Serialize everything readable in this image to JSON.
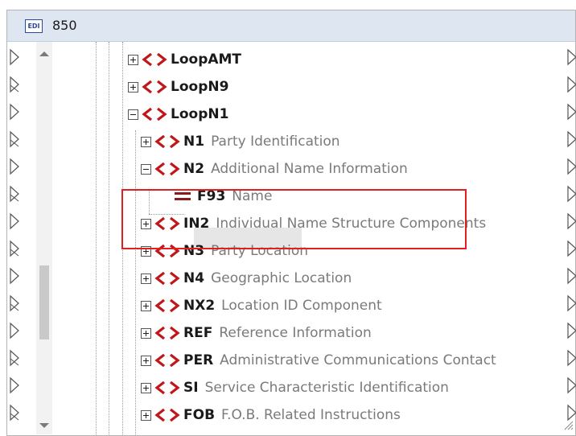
{
  "window": {
    "icon": "edi-icon",
    "icon_text": "EDI",
    "title": "850"
  },
  "colors": {
    "tag_red": "#c0171a",
    "field_red": "#8b1a1a",
    "highlight_box": "#e02020",
    "titlebar_bg": "#dde6f1"
  },
  "tree": {
    "items": [
      {
        "name": "LoopAMT",
        "desc": "",
        "expander": "plus"
      },
      {
        "name": "LoopN9",
        "desc": "",
        "expander": "plus"
      },
      {
        "name": "LoopN1",
        "desc": "",
        "expander": "minus"
      },
      {
        "name": "N1",
        "desc": "Party Identification",
        "expander": "plus"
      },
      {
        "name": "N2",
        "desc": "Additional Name Information",
        "expander": "minus"
      },
      {
        "name": "F93",
        "desc": "Name",
        "expander": "none"
      },
      {
        "name": "IN2",
        "desc": "Individual Name Structure Components",
        "expander": "plus"
      },
      {
        "name": "N3",
        "desc": "Party Location",
        "expander": "plus"
      },
      {
        "name": "N4",
        "desc": "Geographic Location",
        "expander": "plus"
      },
      {
        "name": "NX2",
        "desc": "Location ID Component",
        "expander": "plus"
      },
      {
        "name": "REF",
        "desc": "Reference Information",
        "expander": "plus"
      },
      {
        "name": "PER",
        "desc": "Administrative Communications Contact",
        "expander": "plus"
      },
      {
        "name": "SI",
        "desc": "Service Characteristic Identification",
        "expander": "plus"
      },
      {
        "name": "FOB",
        "desc": "F.O.B. Related Instructions",
        "expander": "plus"
      }
    ]
  }
}
